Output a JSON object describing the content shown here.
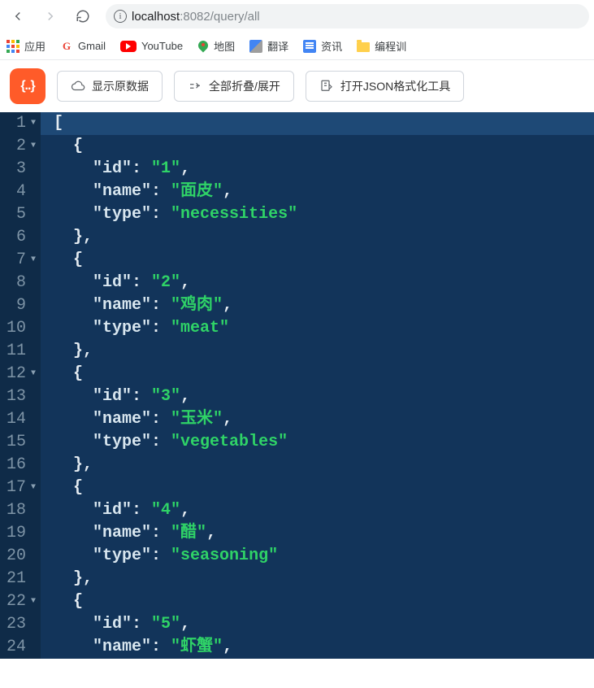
{
  "nav": {
    "url_host": "localhost",
    "url_port": ":8082",
    "url_path": "/query/all"
  },
  "bookmarks": {
    "apps": "应用",
    "gmail": "Gmail",
    "youtube": "YouTube",
    "maps": "地图",
    "translate": "翻译",
    "news": "资讯",
    "folder": "编程训"
  },
  "toolbar": {
    "logo": "{..}",
    "show_raw": "显示原数据",
    "collapse": "全部折叠/展开",
    "open_tool": "打开JSON格式化工具"
  },
  "json_lines": [
    {
      "n": 1,
      "fold": true,
      "indent": 0,
      "tokens": [
        {
          "t": "punc",
          "v": "["
        }
      ],
      "hl": true
    },
    {
      "n": 2,
      "fold": true,
      "indent": 1,
      "tokens": [
        {
          "t": "punc",
          "v": "{"
        }
      ]
    },
    {
      "n": 3,
      "fold": false,
      "indent": 2,
      "tokens": [
        {
          "t": "key",
          "v": "\"id\""
        },
        {
          "t": "punc",
          "v": ": "
        },
        {
          "t": "str",
          "v": "\"1\""
        },
        {
          "t": "punc",
          "v": ","
        }
      ]
    },
    {
      "n": 4,
      "fold": false,
      "indent": 2,
      "tokens": [
        {
          "t": "key",
          "v": "\"name\""
        },
        {
          "t": "punc",
          "v": ": "
        },
        {
          "t": "str",
          "v": "\"面皮\""
        },
        {
          "t": "punc",
          "v": ","
        }
      ]
    },
    {
      "n": 5,
      "fold": false,
      "indent": 2,
      "tokens": [
        {
          "t": "key",
          "v": "\"type\""
        },
        {
          "t": "punc",
          "v": ": "
        },
        {
          "t": "str",
          "v": "\"necessities\""
        }
      ]
    },
    {
      "n": 6,
      "fold": false,
      "indent": 1,
      "tokens": [
        {
          "t": "punc",
          "v": "},"
        }
      ]
    },
    {
      "n": 7,
      "fold": true,
      "indent": 1,
      "tokens": [
        {
          "t": "punc",
          "v": "{"
        }
      ]
    },
    {
      "n": 8,
      "fold": false,
      "indent": 2,
      "tokens": [
        {
          "t": "key",
          "v": "\"id\""
        },
        {
          "t": "punc",
          "v": ": "
        },
        {
          "t": "str",
          "v": "\"2\""
        },
        {
          "t": "punc",
          "v": ","
        }
      ]
    },
    {
      "n": 9,
      "fold": false,
      "indent": 2,
      "tokens": [
        {
          "t": "key",
          "v": "\"name\""
        },
        {
          "t": "punc",
          "v": ": "
        },
        {
          "t": "str",
          "v": "\"鸡肉\""
        },
        {
          "t": "punc",
          "v": ","
        }
      ]
    },
    {
      "n": 10,
      "fold": false,
      "indent": 2,
      "tokens": [
        {
          "t": "key",
          "v": "\"type\""
        },
        {
          "t": "punc",
          "v": ": "
        },
        {
          "t": "str",
          "v": "\"meat\""
        }
      ]
    },
    {
      "n": 11,
      "fold": false,
      "indent": 1,
      "tokens": [
        {
          "t": "punc",
          "v": "},"
        }
      ]
    },
    {
      "n": 12,
      "fold": true,
      "indent": 1,
      "tokens": [
        {
          "t": "punc",
          "v": "{"
        }
      ]
    },
    {
      "n": 13,
      "fold": false,
      "indent": 2,
      "tokens": [
        {
          "t": "key",
          "v": "\"id\""
        },
        {
          "t": "punc",
          "v": ": "
        },
        {
          "t": "str",
          "v": "\"3\""
        },
        {
          "t": "punc",
          "v": ","
        }
      ]
    },
    {
      "n": 14,
      "fold": false,
      "indent": 2,
      "tokens": [
        {
          "t": "key",
          "v": "\"name\""
        },
        {
          "t": "punc",
          "v": ": "
        },
        {
          "t": "str",
          "v": "\"玉米\""
        },
        {
          "t": "punc",
          "v": ","
        }
      ]
    },
    {
      "n": 15,
      "fold": false,
      "indent": 2,
      "tokens": [
        {
          "t": "key",
          "v": "\"type\""
        },
        {
          "t": "punc",
          "v": ": "
        },
        {
          "t": "str",
          "v": "\"vegetables\""
        }
      ]
    },
    {
      "n": 16,
      "fold": false,
      "indent": 1,
      "tokens": [
        {
          "t": "punc",
          "v": "},"
        }
      ]
    },
    {
      "n": 17,
      "fold": true,
      "indent": 1,
      "tokens": [
        {
          "t": "punc",
          "v": "{"
        }
      ]
    },
    {
      "n": 18,
      "fold": false,
      "indent": 2,
      "tokens": [
        {
          "t": "key",
          "v": "\"id\""
        },
        {
          "t": "punc",
          "v": ": "
        },
        {
          "t": "str",
          "v": "\"4\""
        },
        {
          "t": "punc",
          "v": ","
        }
      ]
    },
    {
      "n": 19,
      "fold": false,
      "indent": 2,
      "tokens": [
        {
          "t": "key",
          "v": "\"name\""
        },
        {
          "t": "punc",
          "v": ": "
        },
        {
          "t": "str",
          "v": "\"醋\""
        },
        {
          "t": "punc",
          "v": ","
        }
      ]
    },
    {
      "n": 20,
      "fold": false,
      "indent": 2,
      "tokens": [
        {
          "t": "key",
          "v": "\"type\""
        },
        {
          "t": "punc",
          "v": ": "
        },
        {
          "t": "str",
          "v": "\"seasoning\""
        }
      ]
    },
    {
      "n": 21,
      "fold": false,
      "indent": 1,
      "tokens": [
        {
          "t": "punc",
          "v": "},"
        }
      ]
    },
    {
      "n": 22,
      "fold": true,
      "indent": 1,
      "tokens": [
        {
          "t": "punc",
          "v": "{"
        }
      ]
    },
    {
      "n": 23,
      "fold": false,
      "indent": 2,
      "tokens": [
        {
          "t": "key",
          "v": "\"id\""
        },
        {
          "t": "punc",
          "v": ": "
        },
        {
          "t": "str",
          "v": "\"5\""
        },
        {
          "t": "punc",
          "v": ","
        }
      ]
    },
    {
      "n": 24,
      "fold": false,
      "indent": 2,
      "tokens": [
        {
          "t": "key",
          "v": "\"name\""
        },
        {
          "t": "punc",
          "v": ": "
        },
        {
          "t": "str",
          "v": "\"虾蟹\""
        },
        {
          "t": "punc",
          "v": ","
        }
      ]
    }
  ]
}
